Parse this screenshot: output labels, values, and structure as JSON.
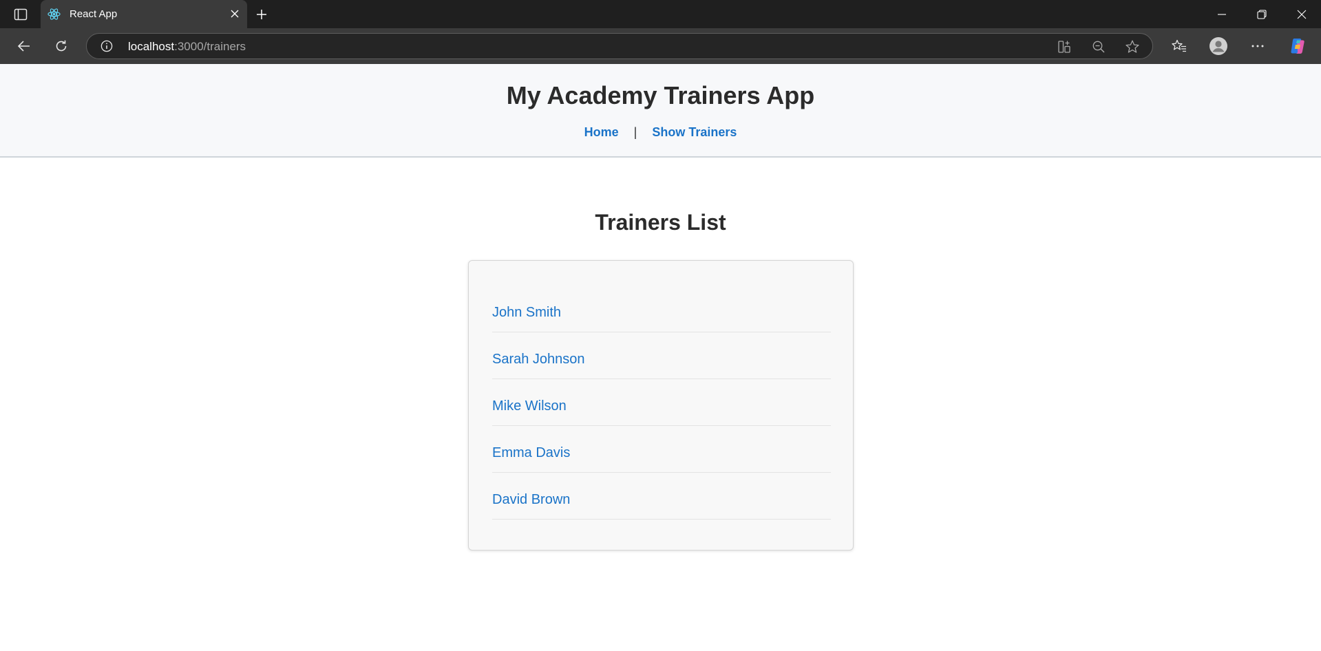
{
  "browser": {
    "tab_title": "React App",
    "url_host": "localhost",
    "url_path": ":3000/trainers",
    "icons": [
      "tab-actions-icon",
      "react-favicon-icon",
      "close-icon",
      "plus-icon",
      "minimize-icon",
      "restore-icon",
      "close-window-icon",
      "back-icon",
      "refresh-icon",
      "info-icon",
      "apps-icon",
      "zoom-out-icon",
      "star-icon",
      "favorites-icon",
      "profile-icon",
      "more-icon",
      "copilot-icon"
    ]
  },
  "header": {
    "title": "My Academy Trainers App",
    "nav": {
      "home": "Home",
      "separator": "|",
      "show_trainers": "Show Trainers"
    }
  },
  "main": {
    "title": "Trainers List",
    "trainers": [
      {
        "name": "John Smith"
      },
      {
        "name": "Sarah Johnson"
      },
      {
        "name": "Mike Wilson"
      },
      {
        "name": "Emma Davis"
      },
      {
        "name": "David Brown"
      }
    ]
  },
  "colors": {
    "link": "#1a73c8",
    "heading": "#2b2b2b",
    "header_bg": "#f7f8fa",
    "card_bg": "#f8f8f8"
  }
}
